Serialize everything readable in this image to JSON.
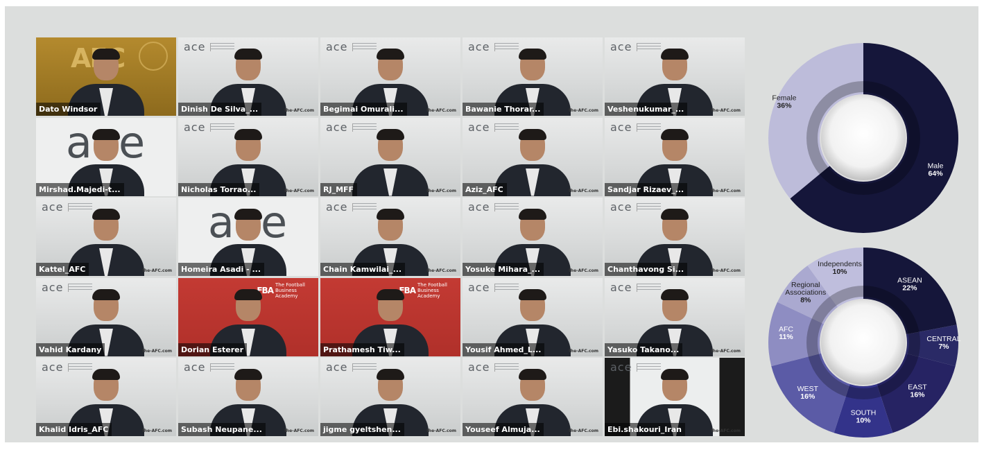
{
  "participants": [
    {
      "name": "Dato Windsor",
      "style": "gold"
    },
    {
      "name": "Dinish De Silva_...",
      "style": "ace"
    },
    {
      "name": "Begimai Omurali...",
      "style": "ace"
    },
    {
      "name": "Bawanie Thorar...",
      "style": "ace"
    },
    {
      "name": "Veshenukumar_...",
      "style": "ace"
    },
    {
      "name": "Mirshad.Majedi-t...",
      "style": "logo"
    },
    {
      "name": "Nicholas Torrao...",
      "style": "ace"
    },
    {
      "name": "RJ_MFF",
      "style": "ace"
    },
    {
      "name": "Aziz_AFC",
      "style": "ace"
    },
    {
      "name": "Sandjar Rizaev_...",
      "style": "ace"
    },
    {
      "name": "Kattel_AFC",
      "style": "ace"
    },
    {
      "name": "Homeira Asadi - ...",
      "style": "logo"
    },
    {
      "name": "Chain Kamwilai_...",
      "style": "ace"
    },
    {
      "name": "Yosuke Mihara_...",
      "style": "ace"
    },
    {
      "name": "Chanthavong Si...",
      "style": "ace"
    },
    {
      "name": "Vahid Kardany",
      "style": "ace"
    },
    {
      "name": "Dorian Esterer",
      "style": "red"
    },
    {
      "name": "Prathamesh Tiw...",
      "style": "red"
    },
    {
      "name": "Yousif Ahmed_L...",
      "style": "ace"
    },
    {
      "name": "Yasuko Takano...",
      "style": "ace"
    },
    {
      "name": "Khalid Idris_AFC",
      "style": "ace"
    },
    {
      "name": "Subash Neupane...",
      "style": "ace"
    },
    {
      "name": "jigme gyeltshen...",
      "style": "ace"
    },
    {
      "name": "Youseef Almuja...",
      "style": "ace"
    },
    {
      "name": "Ebi.shakouri_Iran",
      "style": "dark"
    }
  ],
  "branding": {
    "ace_logo": "ace",
    "fba_mark": "FBA",
    "fba_text": "The Football Business Academy",
    "afc_logo": "AFC",
    "watermark": "the-AFC.com"
  },
  "chart_data": [
    {
      "type": "pie",
      "title": "",
      "categories": [
        "Male",
        "Female"
      ],
      "values": [
        64,
        36
      ],
      "labels": [
        "64%",
        "36%"
      ],
      "colors": [
        "#15163a",
        "#bdbcda"
      ]
    },
    {
      "type": "pie",
      "title": "",
      "categories": [
        "ASEAN",
        "CENTRAL",
        "EAST",
        "SOUTH",
        "WEST",
        "AFC",
        "Regional Associations",
        "Independents"
      ],
      "values": [
        22,
        7,
        16,
        10,
        16,
        11,
        8,
        10
      ],
      "labels": [
        "22%",
        "7%",
        "16%",
        "10%",
        "16%",
        "11%",
        "8%",
        "10%"
      ],
      "colors": [
        "#15163a",
        "#2a2a66",
        "#262363",
        "#33338a",
        "#5b5ba6",
        "#8e8dc2",
        "#aaa9d0",
        "#bfbedd"
      ]
    }
  ]
}
